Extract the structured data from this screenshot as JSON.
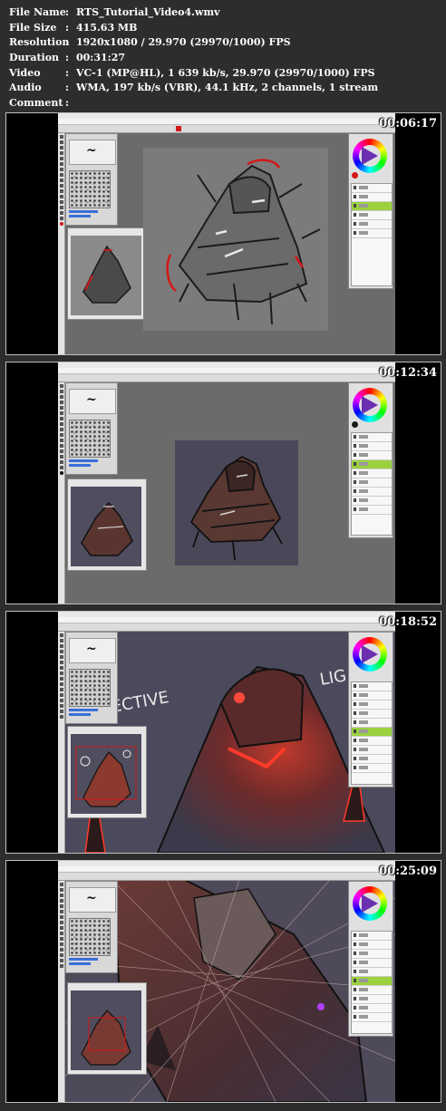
{
  "info": [
    {
      "key": "File Name",
      "value": "RTS_Tutorial_Video4.wmv"
    },
    {
      "key": "File Size",
      "value": "415.63 MB"
    },
    {
      "key": "Resolution",
      "value": "1920x1080 / 29.970 (29970/1000) FPS"
    },
    {
      "key": "Duration",
      "value": "00:31:27"
    },
    {
      "key": "Video",
      "value": "VC-1 (MP@HL), 1 639 kb/s, 29.970 (29970/1000) FPS"
    },
    {
      "key": "Audio",
      "value": "WMA, 197 kb/s (VBR), 44.1 kHz, 2 channels, 1 stream"
    },
    {
      "key": "Comment",
      "value": ""
    }
  ],
  "separator": ":",
  "frames": [
    {
      "timestamp": "00:06:17"
    },
    {
      "timestamp": "00:12:34"
    },
    {
      "timestamp": "00:18:52"
    },
    {
      "timestamp": "00:25:09"
    }
  ],
  "colors": {
    "accent_red": "#d21818",
    "layer_selected": "#9ad13c",
    "background": "#2d2d2d"
  },
  "icons": [
    "brush-icon",
    "color-wheel-icon",
    "layer-eye-icon"
  ]
}
